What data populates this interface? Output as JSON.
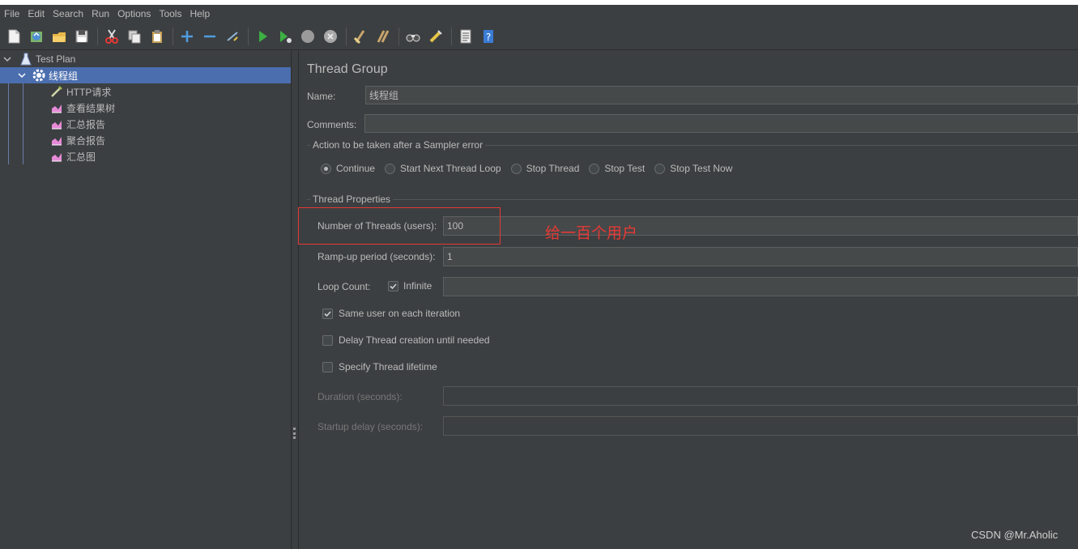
{
  "menu": [
    "File",
    "Edit",
    "Search",
    "Run",
    "Options",
    "Tools",
    "Help"
  ],
  "toolbar_icons": [
    "new-icon",
    "templates-icon",
    "open-icon",
    "save-icon",
    "cut-icon",
    "copy-icon",
    "paste-icon",
    "expand-icon",
    "collapse-icon",
    "toggle-icon",
    "start-icon",
    "start-no-pauses-icon",
    "stop-icon",
    "shutdown-icon",
    "clear-icon",
    "clear-all-icon",
    "search-icon",
    "reset-search-icon",
    "function-helper-icon",
    "help-icon"
  ],
  "tree": {
    "test_plan": "Test Plan",
    "thread_group": "线程组",
    "children": [
      "HTTP请求",
      "查看结果树",
      "汇总报告",
      "聚合报告",
      "汇总图"
    ]
  },
  "panel": {
    "title": "Thread Group",
    "name_label": "Name:",
    "name_value": "线程组",
    "comments_label": "Comments:",
    "comments_value": "",
    "sampler_error_title": "Action to be taken after a Sampler error",
    "sampler_error_options": [
      "Continue",
      "Start Next Thread Loop",
      "Stop Thread",
      "Stop Test",
      "Stop Test Now"
    ],
    "sampler_error_selected": "Continue",
    "thread_props_title": "Thread Properties",
    "threads_label": "Number of Threads (users):",
    "threads_value": "100",
    "rampup_label": "Ramp-up period (seconds):",
    "rampup_value": "1",
    "loop_label": "Loop Count:",
    "infinite_label": "Infinite",
    "infinite_checked": true,
    "loop_value": "",
    "same_user_label": "Same user on each iteration",
    "same_user_checked": true,
    "delay_label": "Delay Thread creation until needed",
    "delay_checked": false,
    "lifetime_label": "Specify Thread lifetime",
    "lifetime_checked": false,
    "duration_label": "Duration (seconds):",
    "duration_value": "",
    "startup_label": "Startup delay (seconds):",
    "startup_value": ""
  },
  "annotation": "给一百个用户",
  "watermark": "CSDN @Mr.Aholic",
  "colors": {
    "selection": "#4b6eaf",
    "annotation": "#e53935",
    "background": "#3c3f41"
  }
}
